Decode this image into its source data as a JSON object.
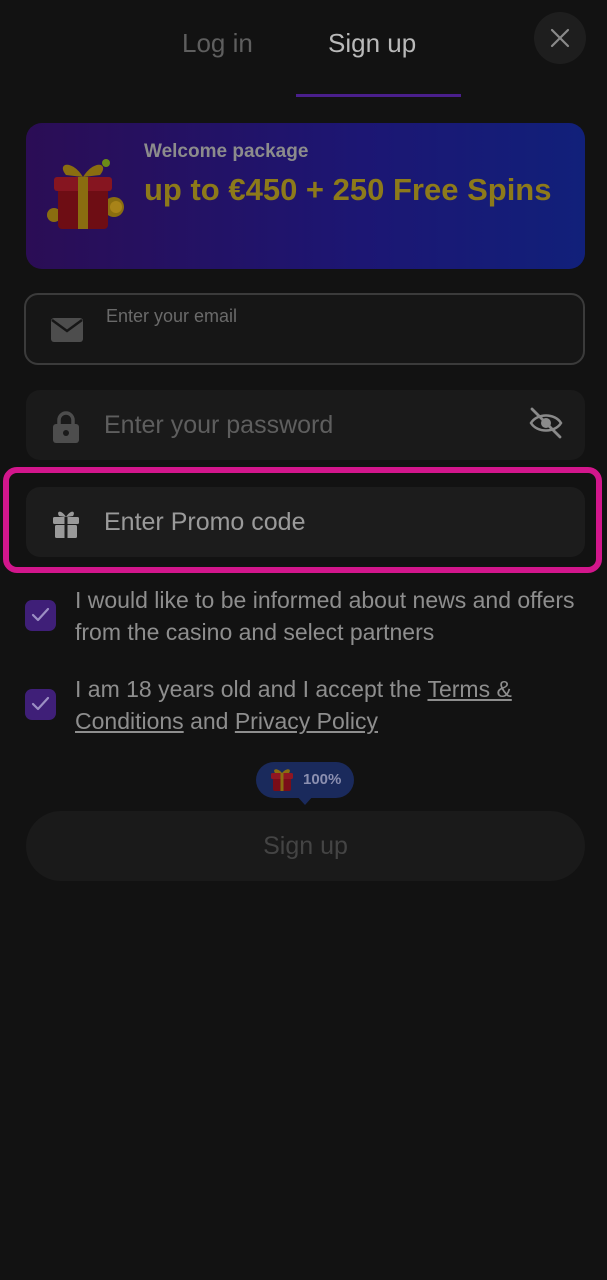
{
  "tabs": {
    "login": "Log in",
    "signup": "Sign up",
    "active": "signup"
  },
  "banner": {
    "subtitle": "Welcome package",
    "title": "up to €450 + 250 Free Spins"
  },
  "form": {
    "email_placeholder": "Enter your email",
    "password_placeholder": "Enter your password",
    "promo_placeholder": "Enter Promo code"
  },
  "checkboxes": {
    "news": {
      "checked": true,
      "text": "I would like to be informed about news and offers from the casino and select partners"
    },
    "terms": {
      "checked": true,
      "text_before": "I am 18 years old and I accept the ",
      "terms_link": "Terms & Conditions",
      "text_middle": " and ",
      "privacy_link": "Privacy Policy"
    }
  },
  "bonus_badge": {
    "text": "100%"
  },
  "signup_button": {
    "label": "Sign up"
  },
  "colors": {
    "accent": "#4a1f8c",
    "highlight": "#d2168c",
    "banner_text": "#8d7a1a",
    "checkbox": "#3f1f78"
  },
  "icons": [
    "close-icon",
    "gift-icon",
    "envelope-icon",
    "lock-icon",
    "eye-slash-icon",
    "checkmark-icon"
  ]
}
